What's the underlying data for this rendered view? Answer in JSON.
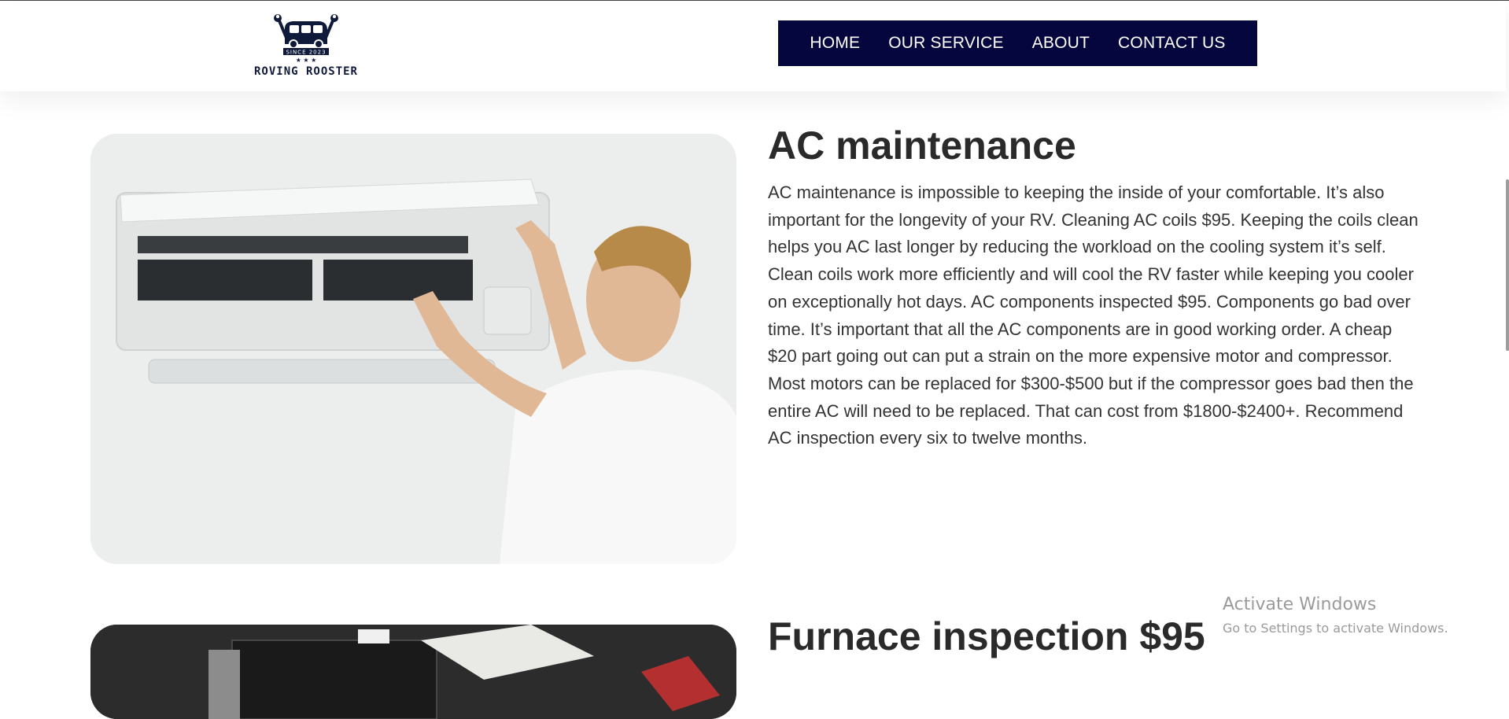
{
  "brand": {
    "logo_text": "ROVING ROOSTER",
    "badge_text": "SINCE 2023",
    "logo_icon": "van-wrench-logo",
    "color": "#0f1a3a"
  },
  "nav": {
    "bg_color": "#06063f",
    "items": [
      {
        "label": "HOME"
      },
      {
        "label": "OUR SERVICE"
      },
      {
        "label": "ABOUT"
      },
      {
        "label": "CONTACT US"
      }
    ]
  },
  "sections": [
    {
      "title": "AC maintenance",
      "image_icon": "ac-technician-photo",
      "body": "AC maintenance is impossible to keeping the inside of your comfortable. It’s also important for the longevity of your RV. Cleaning AC coils $95. Keeping the coils clean helps you AC last longer by reducing the workload on the cooling system it’s self. Clean coils work more efficiently and will cool the RV faster while keeping you cooler on exceptionally hot days. AC components inspected $95. Components go bad over time. It’s important that all the AC components are in good working order. A cheap $20 part going out can put a strain on the more expensive motor and compressor. Most motors can be replaced for $300-$500 but if the compressor goes bad then the entire AC will need to be replaced. That can cost from $1800-$2400+. Recommend AC inspection every six to twelve months."
    },
    {
      "title": "Furnace inspection $95",
      "image_icon": "furnace-photo"
    }
  ],
  "watermark": {
    "title": "Activate Windows",
    "subtitle": "Go to Settings to activate Windows."
  }
}
